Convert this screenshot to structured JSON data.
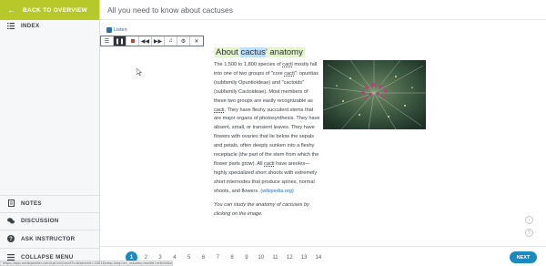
{
  "sidebar": {
    "back_label": "BACK TO OVERVIEW",
    "index_label": "INDEX",
    "notes_label": "NOTES",
    "discussion_label": "DISCUSSION",
    "ask_label": "ASK INSTRUCTOR",
    "collapse_label": "COLLAPSE MENU"
  },
  "header": {
    "title": "All you need to know about cactuses"
  },
  "readspeaker": {
    "listen_label": "Listen"
  },
  "article": {
    "title_pre": "About ",
    "title_hl": "cactus",
    "title_post": "' anatomy",
    "body": [
      "The 1,500 to 1,800 species of ",
      "cacti",
      " mostly fall into one of two groups of \"core ",
      "cacti",
      "\": opuntias (subfamily Opuntioideae) and \"cactoids\" (subfamily Cactoideae). Most members of these two groups are easily recognizable as ",
      "cacti",
      ". They have fleshy succulent stems that are major organs of photosynthesis. They have absent, small, or transient leaves. They have flowers with ovaries that lie below the sepals and petals, often deeply sunken into a fleshy receptacle (the part of the stem from which the flower parts grow). All ",
      "cacti",
      " have areoles—highly specialized short shoots with extremely short internodes that produce spines, normal shoots, and flowers. "
    ],
    "source_link": "(wikipedia.org)",
    "note": "You can study the anatomy of cactuses by clicking on the image."
  },
  "pagination": {
    "pages": [
      "1",
      "2",
      "3",
      "4",
      "5",
      "6",
      "7",
      "8",
      "9",
      "10",
      "11",
      "12",
      "13",
      "14"
    ],
    "active_index": 0,
    "next_label": "NEXT"
  },
  "status_url": "https://app.readspeaker.com/cgi-bin/rsent?customerid=1001&amp;lang=en_us&amp;readid=article&amp;url=...",
  "colors": {
    "accent_green": "#b7c928",
    "accent_blue": "#1a8bc2"
  }
}
